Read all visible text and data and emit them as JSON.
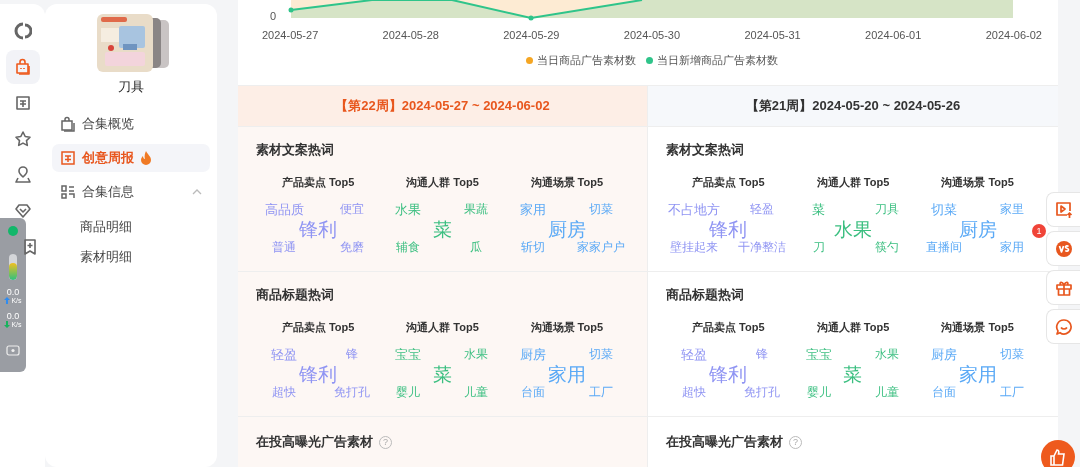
{
  "rail": [
    {
      "kind": "logo",
      "selected": false
    },
    {
      "kind": "bag",
      "selected": true
    },
    {
      "kind": "sheet",
      "selected": false
    },
    {
      "kind": "star",
      "selected": false
    },
    {
      "kind": "pin",
      "selected": false
    },
    {
      "kind": "gem",
      "selected": false
    },
    {
      "kind": "bookmark",
      "selected": false
    }
  ],
  "monitor": {
    "level": 0.65,
    "rates": [
      {
        "kind": "up",
        "value": "0.0",
        "unit": "K/s"
      },
      {
        "kind": "down",
        "value": "0.0",
        "unit": "K/s"
      }
    ]
  },
  "collection": {
    "name": "刀具"
  },
  "nav": [
    {
      "label": "合集概览",
      "selected": false
    },
    {
      "label": "创意周报",
      "selected": true,
      "hot": true
    },
    {
      "label": "合集信息",
      "selected": false,
      "expanded": true,
      "children": [
        {
          "label": "商品明细",
          "selected": false
        },
        {
          "label": "素材明细",
          "selected": false
        }
      ]
    }
  ],
  "chart": {
    "y_tick": "0",
    "x_labels": [
      "2024-05-27",
      "2024-05-28",
      "2024-05-29",
      "2024-05-30",
      "2024-05-31",
      "2024-06-01",
      "2024-06-02"
    ],
    "legend": [
      {
        "label": "当日商品广告素材数",
        "color": "#f5a623"
      },
      {
        "label": "当日新增商品广告素材数",
        "color": "#2fc48a"
      }
    ]
  },
  "weeks": [
    {
      "title": "【第22周】2024-05-27 ~ 2024-06-02",
      "current": true,
      "sections": [
        {
          "title": "素材文案热词",
          "clouds": [
            {
              "title": "产品卖点 Top5",
              "color": "#8f94f3",
              "words": [
                "高品质",
                "便宜",
                "锋利",
                "普通",
                "免磨"
              ]
            },
            {
              "title": "沟通人群 Top5",
              "color": "#3bbf80",
              "words": [
                "水果",
                "果蔬",
                "菜",
                "辅食",
                "瓜"
              ]
            },
            {
              "title": "沟通场景 Top5",
              "color": "#5aa9f6",
              "words": [
                "家用",
                "切菜",
                "厨房",
                "斩切",
                "家家户户"
              ]
            }
          ]
        },
        {
          "title": "商品标题热词",
          "clouds": [
            {
              "title": "产品卖点 Top5",
              "color": "#8f94f3",
              "words": [
                "轻盈",
                "锋",
                "锋利",
                "超快",
                "免打孔"
              ]
            },
            {
              "title": "沟通人群 Top5",
              "color": "#3bbf80",
              "words": [
                "宝宝",
                "水果",
                "菜",
                "婴儿",
                "儿童"
              ]
            },
            {
              "title": "沟通场景 Top5",
              "color": "#5aa9f6",
              "words": [
                "厨房",
                "切菜",
                "家用",
                "台面",
                "工厂"
              ]
            }
          ]
        }
      ],
      "more": {
        "title": "在投高曝光广告素材",
        "help": "?"
      }
    },
    {
      "title": "【第21周】2024-05-20 ~ 2024-05-26",
      "current": false,
      "sections": [
        {
          "title": "素材文案热词",
          "clouds": [
            {
              "title": "产品卖点 Top5",
              "color": "#8f94f3",
              "words": [
                "不占地方",
                "轻盈",
                "锋利",
                "壁挂起来",
                "干净整洁"
              ]
            },
            {
              "title": "沟通人群 Top5",
              "color": "#3bbf80",
              "words": [
                "菜",
                "刀具",
                "水果",
                "刀",
                "筷勺"
              ]
            },
            {
              "title": "沟通场景 Top5",
              "color": "#5aa9f6",
              "words": [
                "切菜",
                "家里",
                "厨房",
                "直播间",
                "家用"
              ]
            }
          ]
        },
        {
          "title": "商品标题热词",
          "clouds": [
            {
              "title": "产品卖点 Top5",
              "color": "#8f94f3",
              "words": [
                "轻盈",
                "锋",
                "锋利",
                "超快",
                "免打孔"
              ]
            },
            {
              "title": "沟通人群 Top5",
              "color": "#3bbf80",
              "words": [
                "宝宝",
                "水果",
                "菜",
                "婴儿",
                "儿童"
              ]
            },
            {
              "title": "沟通场景 Top5",
              "color": "#5aa9f6",
              "words": [
                "厨房",
                "切菜",
                "家用",
                "台面",
                "工厂"
              ]
            }
          ]
        }
      ],
      "more": {
        "title": "在投高曝光广告素材",
        "help": "?"
      }
    }
  ],
  "float_tools": [
    {
      "kind": "video-upload"
    },
    {
      "kind": "vs",
      "badge": "1"
    },
    {
      "kind": "gift"
    },
    {
      "kind": "chat"
    }
  ]
}
